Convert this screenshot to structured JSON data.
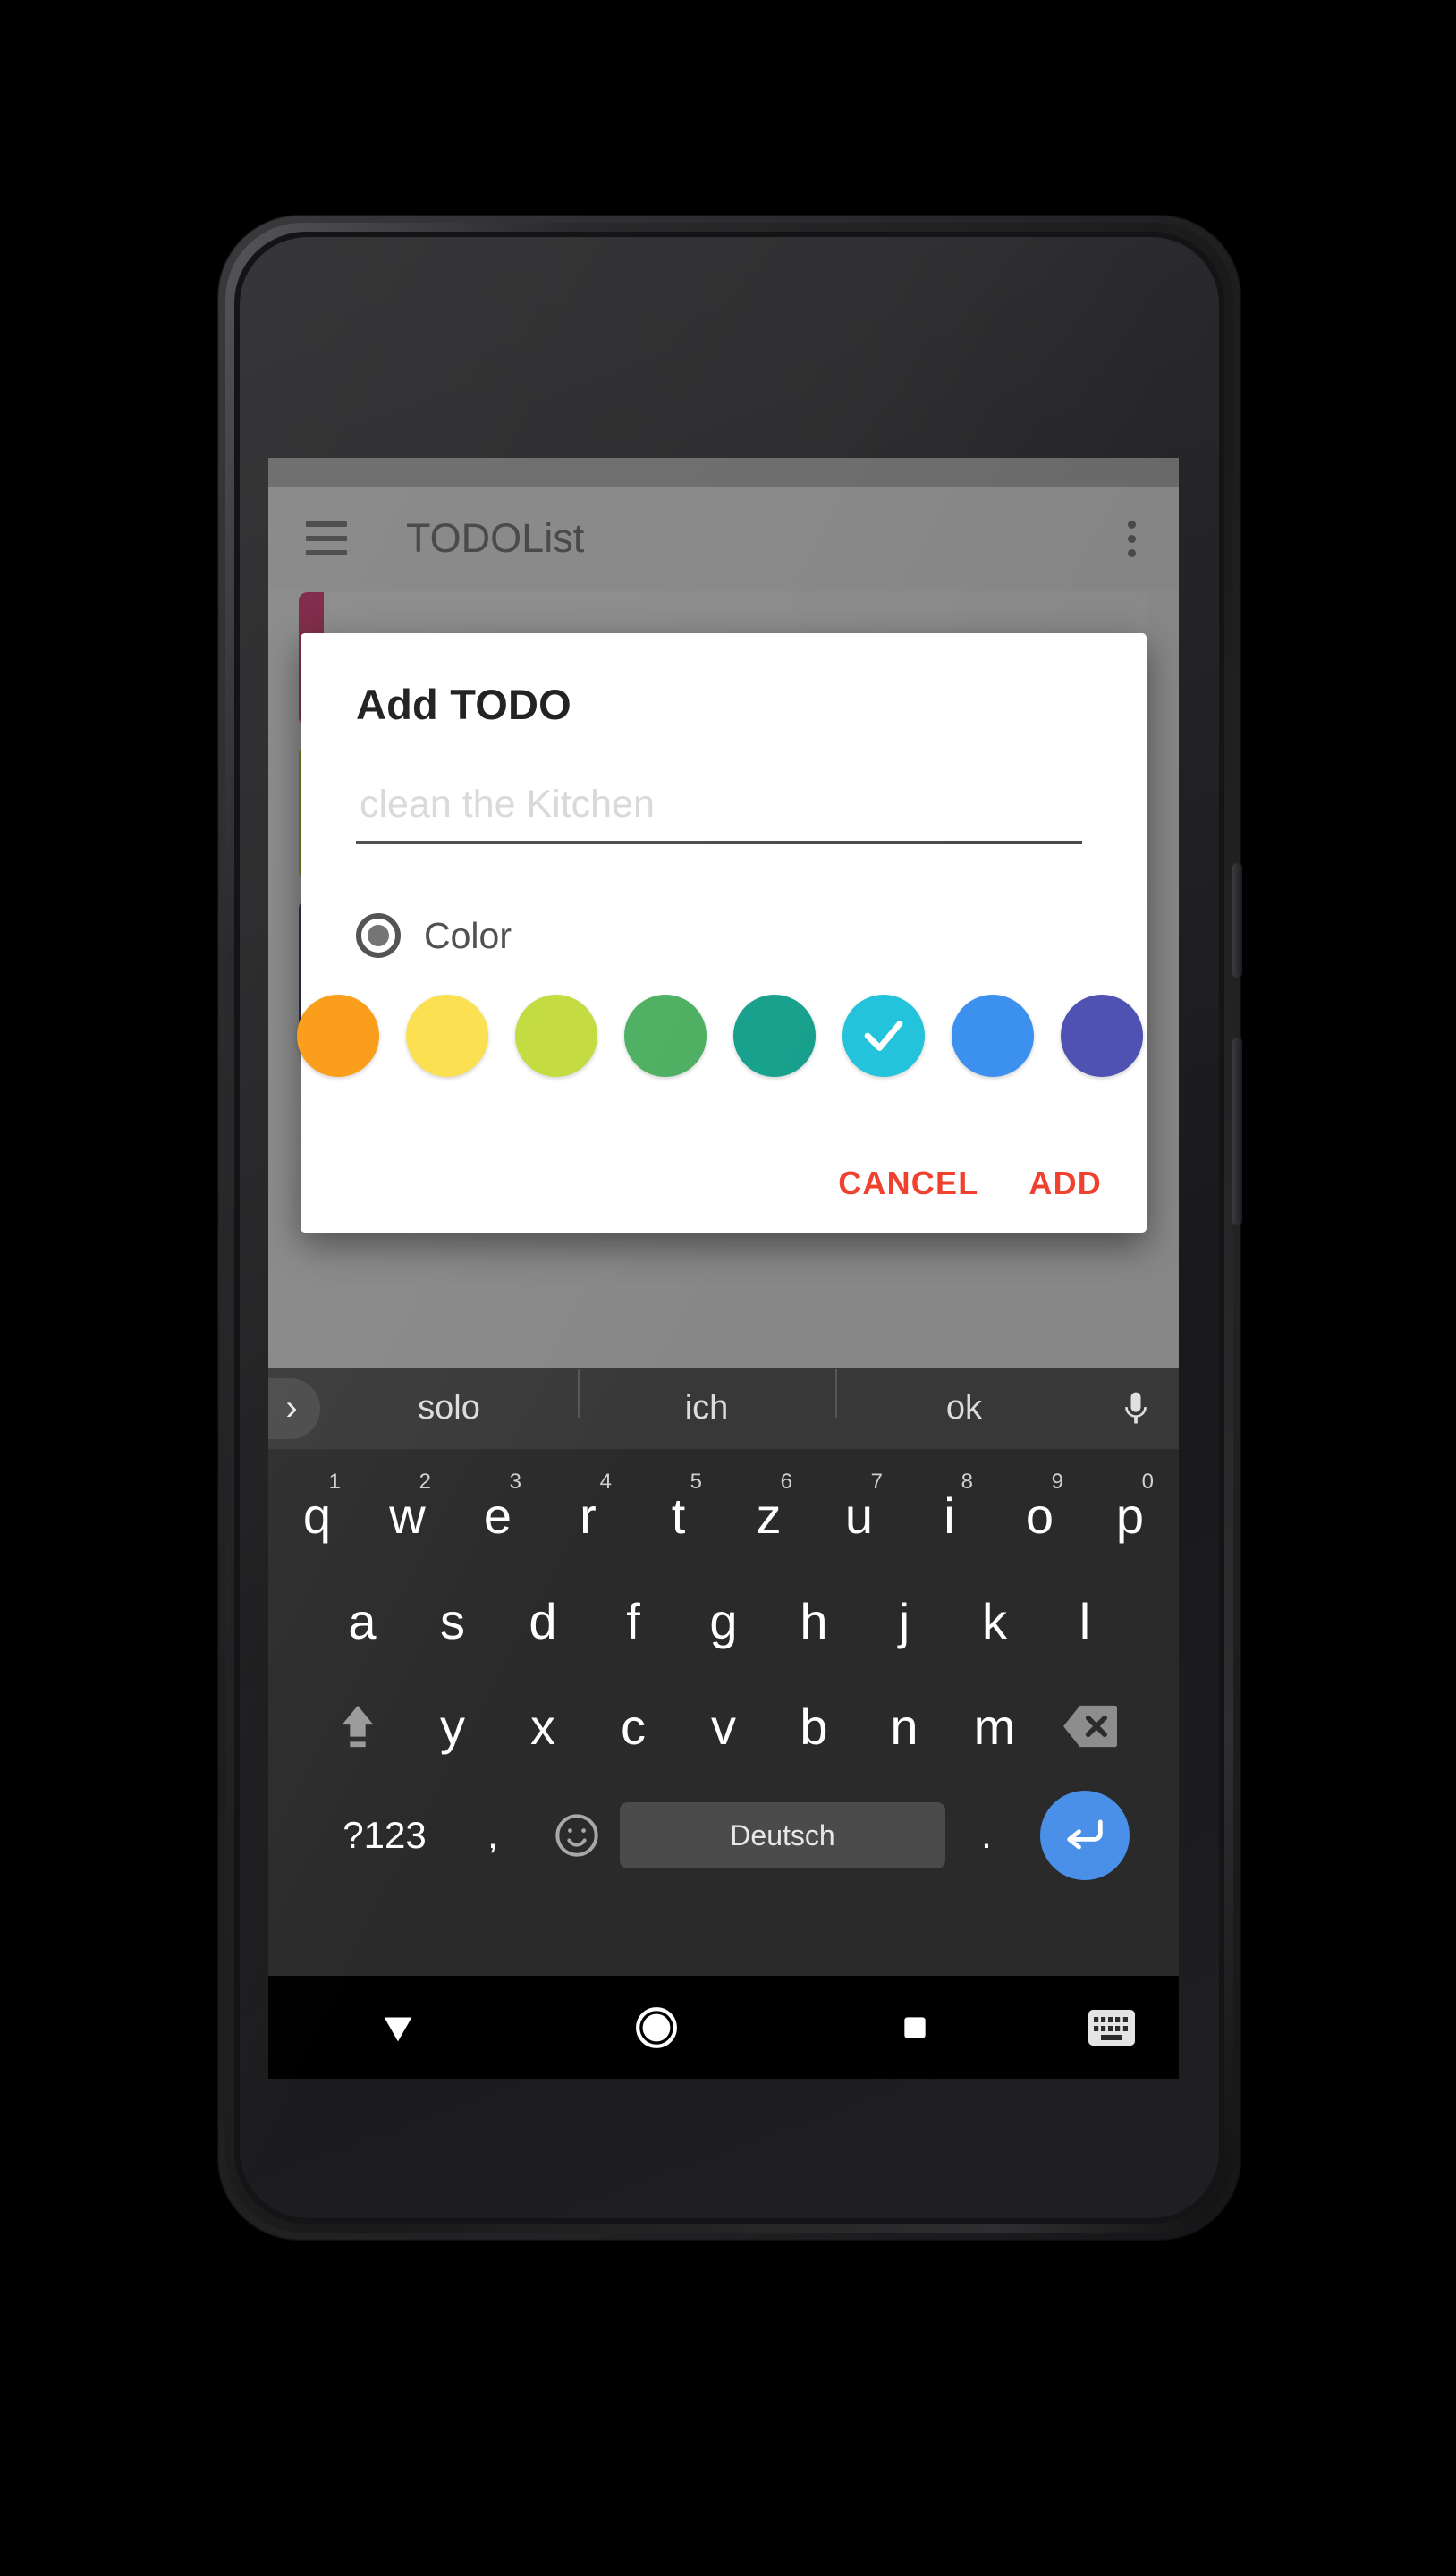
{
  "app": {
    "title": "TODOList",
    "menu_icon": "hamburger-menu-icon",
    "overflow_icon": "overflow-menu-icon"
  },
  "list_cards": [
    {
      "accent": "#8e2b4d"
    },
    {
      "accent": "#8b8a20"
    },
    {
      "accent": "#242a55"
    }
  ],
  "dialog": {
    "title": "Add TODO",
    "input_value": "",
    "input_placeholder": "clean the Kitchen",
    "color_label": "Color",
    "radio_selected": true,
    "cancel_label": "CANCEL",
    "add_label": "ADD",
    "action_color": "#f0412f",
    "swatches": [
      {
        "name": "orange",
        "hex": "#FB9A12",
        "selected": false
      },
      {
        "name": "yellow",
        "hex": "#FBE04B",
        "selected": false
      },
      {
        "name": "lime",
        "hex": "#C2DB3C",
        "selected": false
      },
      {
        "name": "green",
        "hex": "#4CAF61",
        "selected": false
      },
      {
        "name": "teal",
        "hex": "#16A08C",
        "selected": false
      },
      {
        "name": "cyan",
        "hex": "#23C3DC",
        "selected": true
      },
      {
        "name": "blue",
        "hex": "#3C90EE",
        "selected": false
      },
      {
        "name": "indigo",
        "hex": "#4F52B2",
        "selected": false
      }
    ]
  },
  "keyboard": {
    "suggestions": [
      "solo",
      "ich",
      "ok"
    ],
    "expand_icon": "chevron-right-icon",
    "mic_icon": "microphone-icon",
    "row1": [
      {
        "key": "q",
        "hint": "1"
      },
      {
        "key": "w",
        "hint": "2"
      },
      {
        "key": "e",
        "hint": "3"
      },
      {
        "key": "r",
        "hint": "4"
      },
      {
        "key": "t",
        "hint": "5"
      },
      {
        "key": "z",
        "hint": "6"
      },
      {
        "key": "u",
        "hint": "7"
      },
      {
        "key": "i",
        "hint": "8"
      },
      {
        "key": "o",
        "hint": "9"
      },
      {
        "key": "p",
        "hint": "0"
      }
    ],
    "row2": [
      "a",
      "s",
      "d",
      "f",
      "g",
      "h",
      "j",
      "k",
      "l"
    ],
    "row3": [
      "y",
      "x",
      "c",
      "v",
      "b",
      "n",
      "m"
    ],
    "shift_icon": "shift-up-arrow-icon",
    "backspace_icon": "backspace-delete-icon",
    "symbols_label": "?123",
    "comma_label": ",",
    "emoji_icon": "smiley-emoji-icon",
    "space_label": "Deutsch",
    "period_label": ".",
    "enter_icon": "enter-return-icon",
    "enter_color": "#4a90e8"
  },
  "navbar": {
    "back_icon": "hide-keyboard-down-arrow-icon",
    "home_icon": "home-circle-icon",
    "recents_icon": "recents-square-icon",
    "switch_keyboard_icon": "keyboard-switcher-icon"
  }
}
